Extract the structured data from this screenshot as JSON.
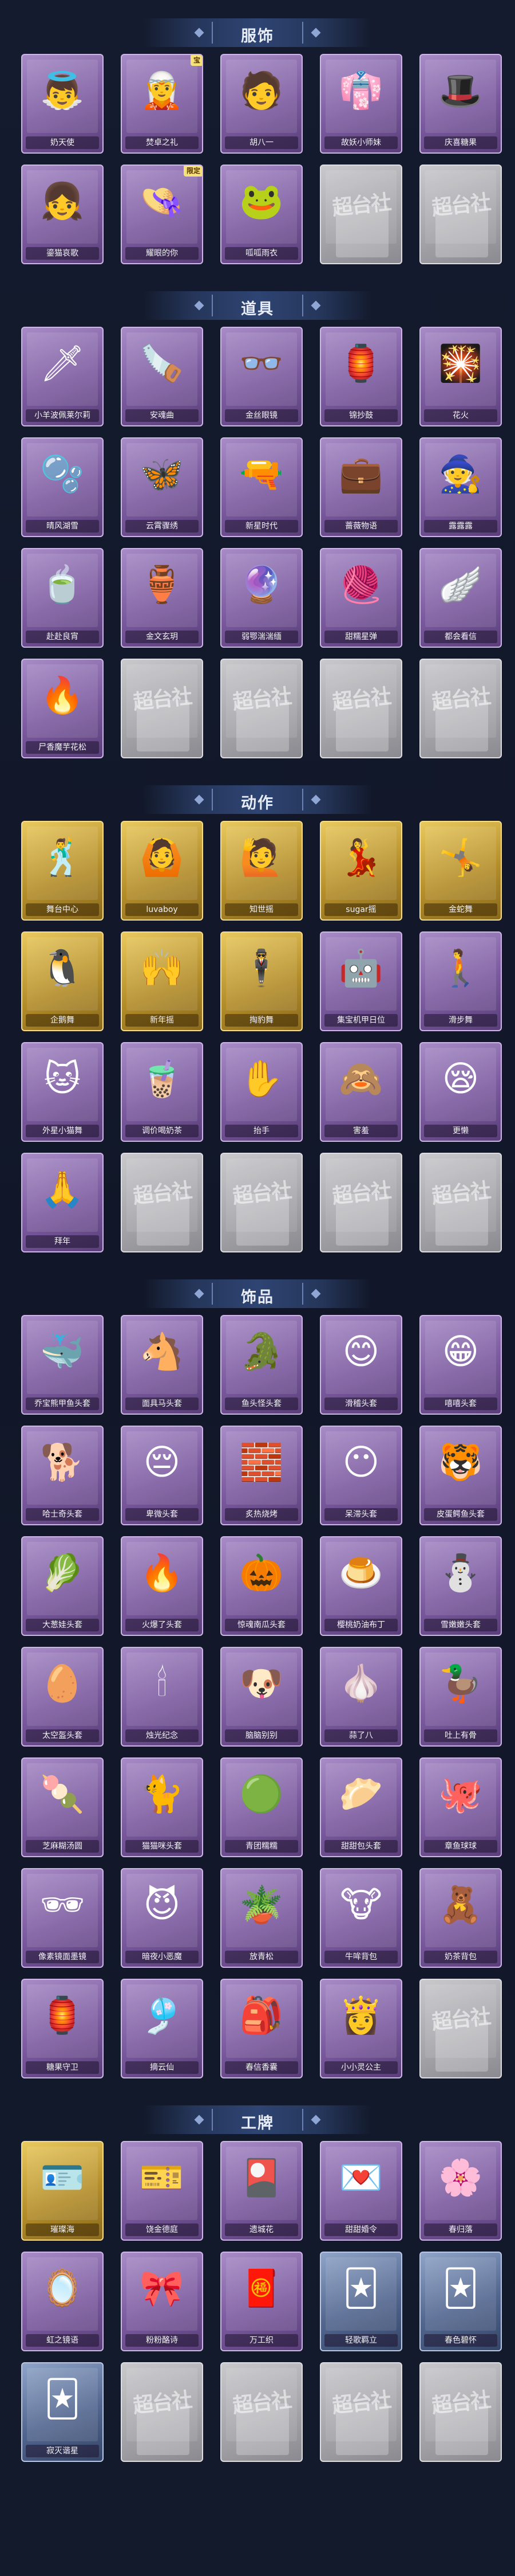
{
  "watermark": "超台社",
  "sections": [
    {
      "title": "服饰",
      "items": [
        {
          "label": "奶天使",
          "icon": "👼",
          "style": "purple",
          "badge": ""
        },
        {
          "label": "焚卓之礼",
          "icon": "🧝",
          "style": "purple",
          "badge": "宝"
        },
        {
          "label": "胡八一",
          "icon": "🧑",
          "style": "purple",
          "badge": ""
        },
        {
          "label": "故妖小师妹",
          "icon": "👘",
          "style": "purple",
          "badge": ""
        },
        {
          "label": "庆喜糖果",
          "icon": "🎩",
          "style": "purple",
          "badge": ""
        },
        {
          "label": "鎏猫哀歌",
          "icon": "👧",
          "style": "purple",
          "badge": ""
        },
        {
          "label": "耀眼的你",
          "icon": "👒",
          "style": "purple",
          "badge": "限定"
        },
        {
          "label": "呱呱雨衣",
          "icon": "🐸",
          "style": "purple",
          "badge": ""
        },
        {
          "label": "",
          "icon": "",
          "style": "gray",
          "badge": ""
        },
        {
          "label": "",
          "icon": "",
          "style": "gray",
          "badge": ""
        }
      ]
    },
    {
      "title": "道具",
      "items": [
        {
          "label": "小羊波佩莱尔莉",
          "icon": "🗡",
          "style": "purple",
          "badge": ""
        },
        {
          "label": "安魂曲",
          "icon": "🪚",
          "style": "purple",
          "badge": ""
        },
        {
          "label": "金丝眼镜",
          "icon": "👓",
          "style": "purple",
          "badge": ""
        },
        {
          "label": "锦抄鼓",
          "icon": "🏮",
          "style": "purple",
          "badge": ""
        },
        {
          "label": "花火",
          "icon": "🎇",
          "style": "purple",
          "badge": ""
        },
        {
          "label": "晴风湖雪",
          "icon": "🫧",
          "style": "purple",
          "badge": ""
        },
        {
          "label": "云霄骤绣",
          "icon": "🦋",
          "style": "purple",
          "badge": ""
        },
        {
          "label": "新星时代",
          "icon": "🔫",
          "style": "purple",
          "badge": ""
        },
        {
          "label": "蔷薇物语",
          "icon": "💼",
          "style": "purple",
          "badge": ""
        },
        {
          "label": "露露露",
          "icon": "🧙",
          "style": "purple",
          "badge": ""
        },
        {
          "label": "赴赴良宵",
          "icon": "🍵",
          "style": "purple",
          "badge": ""
        },
        {
          "label": "金文玄玥",
          "icon": "🏺",
          "style": "purple",
          "badge": ""
        },
        {
          "label": "弱鄂湍湍缅",
          "icon": "🔮",
          "style": "purple",
          "badge": ""
        },
        {
          "label": "甜糯星弹",
          "icon": "🧶",
          "style": "purple",
          "badge": ""
        },
        {
          "label": "都会看信",
          "icon": "🪽",
          "style": "purple",
          "badge": ""
        },
        {
          "label": "尸香魔芋花松",
          "icon": "🔥",
          "style": "purple",
          "badge": ""
        },
        {
          "label": "",
          "icon": "",
          "style": "gray",
          "badge": ""
        },
        {
          "label": "",
          "icon": "",
          "style": "gray",
          "badge": ""
        },
        {
          "label": "",
          "icon": "",
          "style": "gray",
          "badge": ""
        },
        {
          "label": "",
          "icon": "",
          "style": "gray",
          "badge": ""
        }
      ]
    },
    {
      "title": "动作",
      "items": [
        {
          "label": "舞台中心",
          "icon": "🕺",
          "style": "gold",
          "badge": ""
        },
        {
          "label": "luvaboy",
          "icon": "🙆",
          "style": "gold",
          "badge": ""
        },
        {
          "label": "知世摇",
          "icon": "🙋",
          "style": "gold",
          "badge": ""
        },
        {
          "label": "sugar摇",
          "icon": "💃",
          "style": "gold",
          "badge": ""
        },
        {
          "label": "金蛇舞",
          "icon": "🤸",
          "style": "gold",
          "badge": ""
        },
        {
          "label": "企鹅舞",
          "icon": "🐧",
          "style": "gold",
          "badge": ""
        },
        {
          "label": "新年摇",
          "icon": "🙌",
          "style": "gold",
          "badge": ""
        },
        {
          "label": "掏豹舞",
          "icon": "🕴",
          "style": "gold",
          "badge": ""
        },
        {
          "label": "集宝机甲日位",
          "icon": "🤖",
          "style": "purple",
          "badge": ""
        },
        {
          "label": "滑步舞",
          "icon": "🚶",
          "style": "purple",
          "badge": ""
        },
        {
          "label": "外星小猫舞",
          "icon": "🐱",
          "style": "purple",
          "badge": ""
        },
        {
          "label": "调价喝奶茶",
          "icon": "🧋",
          "style": "purple",
          "badge": ""
        },
        {
          "label": "抬手",
          "icon": "✋",
          "style": "purple",
          "badge": ""
        },
        {
          "label": "害羞",
          "icon": "🙈",
          "style": "purple",
          "badge": ""
        },
        {
          "label": "更懒",
          "icon": "😪",
          "style": "purple",
          "badge": ""
        },
        {
          "label": "拜年",
          "icon": "🙏",
          "style": "purple",
          "badge": ""
        },
        {
          "label": "",
          "icon": "",
          "style": "gray",
          "badge": ""
        },
        {
          "label": "",
          "icon": "",
          "style": "gray",
          "badge": ""
        },
        {
          "label": "",
          "icon": "",
          "style": "gray",
          "badge": ""
        },
        {
          "label": "",
          "icon": "",
          "style": "gray",
          "badge": ""
        }
      ]
    },
    {
      "title": "饰品",
      "items": [
        {
          "label": "乔宝熊甲鱼头套",
          "icon": "🐳",
          "style": "purple",
          "badge": ""
        },
        {
          "label": "面具马头套",
          "icon": "🐴",
          "style": "purple",
          "badge": ""
        },
        {
          "label": "鱼头怪头套",
          "icon": "🐊",
          "style": "purple",
          "badge": ""
        },
        {
          "label": "滑稽头套",
          "icon": "😊",
          "style": "purple",
          "badge": ""
        },
        {
          "label": "嘻嘻头套",
          "icon": "😁",
          "style": "purple",
          "badge": ""
        },
        {
          "label": "哈士奇头套",
          "icon": "🐕",
          "style": "purple",
          "badge": ""
        },
        {
          "label": "卑微头套",
          "icon": "😔",
          "style": "purple",
          "badge": ""
        },
        {
          "label": "炙热烧烤",
          "icon": "🧱",
          "style": "purple",
          "badge": ""
        },
        {
          "label": "呆滞头套",
          "icon": "😶",
          "style": "purple",
          "badge": ""
        },
        {
          "label": "皮蛋鳄鱼头套",
          "icon": "🐯",
          "style": "purple",
          "badge": ""
        },
        {
          "label": "大葱娃头套",
          "icon": "🥬",
          "style": "purple",
          "badge": ""
        },
        {
          "label": "火爆了头套",
          "icon": "🔥",
          "style": "purple",
          "badge": ""
        },
        {
          "label": "惊魂南瓜头套",
          "icon": "🎃",
          "style": "purple",
          "badge": ""
        },
        {
          "label": "樱桃奶油布丁",
          "icon": "🍮",
          "style": "purple",
          "badge": ""
        },
        {
          "label": "雪嫩嫩头套",
          "icon": "⛄",
          "style": "purple",
          "badge": ""
        },
        {
          "label": "太空盔头套",
          "icon": "🥚",
          "style": "purple",
          "badge": ""
        },
        {
          "label": "烛光纪念",
          "icon": "🕯",
          "style": "purple",
          "badge": ""
        },
        {
          "label": "脑脑别别",
          "icon": "🐶",
          "style": "purple",
          "badge": ""
        },
        {
          "label": "蒜了八",
          "icon": "🧄",
          "style": "purple",
          "badge": ""
        },
        {
          "label": "吐上有骨",
          "icon": "🦆",
          "style": "purple",
          "badge": ""
        },
        {
          "label": "芝麻糊汤圆",
          "icon": "🍡",
          "style": "purple",
          "badge": ""
        },
        {
          "label": "猫猫咪头套",
          "icon": "🐈",
          "style": "purple",
          "badge": ""
        },
        {
          "label": "青团糯糯",
          "icon": "🟢",
          "style": "purple",
          "badge": ""
        },
        {
          "label": "甜甜包头套",
          "icon": "🥟",
          "style": "purple",
          "badge": ""
        },
        {
          "label": "章鱼球球",
          "icon": "🐙",
          "style": "purple",
          "badge": ""
        },
        {
          "label": "像素镜面墨镜",
          "icon": "🕶",
          "style": "purple",
          "badge": ""
        },
        {
          "label": "暗夜小恶魔",
          "icon": "😈",
          "style": "purple",
          "badge": ""
        },
        {
          "label": "放青松",
          "icon": "🪴",
          "style": "purple",
          "badge": ""
        },
        {
          "label": "牛哞背包",
          "icon": "🐮",
          "style": "purple",
          "badge": ""
        },
        {
          "label": "奶茶背包",
          "icon": "🧸",
          "style": "purple",
          "badge": ""
        },
        {
          "label": "糖果守卫",
          "icon": "🏮",
          "style": "purple",
          "badge": ""
        },
        {
          "label": "摘云仙",
          "icon": "🎐",
          "style": "purple",
          "badge": ""
        },
        {
          "label": "春信香囊",
          "icon": "🎒",
          "style": "purple",
          "badge": ""
        },
        {
          "label": "小小灵公主",
          "icon": "👸",
          "style": "purple",
          "badge": ""
        },
        {
          "label": "",
          "icon": "",
          "style": "gray",
          "badge": ""
        }
      ]
    },
    {
      "title": "工牌",
      "items": [
        {
          "label": "璀璨海",
          "icon": "🪪",
          "style": "gold",
          "badge": ""
        },
        {
          "label": "饶金德庭",
          "icon": "🎫",
          "style": "purple",
          "badge": ""
        },
        {
          "label": "遗城花",
          "icon": "🎴",
          "style": "purple",
          "badge": ""
        },
        {
          "label": "甜甜婚令",
          "icon": "💌",
          "style": "purple",
          "badge": ""
        },
        {
          "label": "春归落",
          "icon": "🌸",
          "style": "purple",
          "badge": ""
        },
        {
          "label": "虹之镜语",
          "icon": "🪞",
          "style": "purple",
          "badge": ""
        },
        {
          "label": "粉粉酪诗",
          "icon": "🎀",
          "style": "purple",
          "badge": ""
        },
        {
          "label": "万工织",
          "icon": "🧧",
          "style": "purple",
          "badge": ""
        },
        {
          "label": "轻歌羁立",
          "icon": "🃏",
          "style": "blue",
          "badge": ""
        },
        {
          "label": "春色碧怀",
          "icon": "🃏",
          "style": "blue",
          "badge": ""
        },
        {
          "label": "寂灭谐星",
          "icon": "🃏",
          "style": "blue",
          "badge": ""
        },
        {
          "label": "",
          "icon": "",
          "style": "gray",
          "badge": ""
        },
        {
          "label": "",
          "icon": "",
          "style": "gray",
          "badge": ""
        },
        {
          "label": "",
          "icon": "",
          "style": "gray",
          "badge": ""
        },
        {
          "label": "",
          "icon": "",
          "style": "gray",
          "badge": ""
        }
      ]
    }
  ]
}
